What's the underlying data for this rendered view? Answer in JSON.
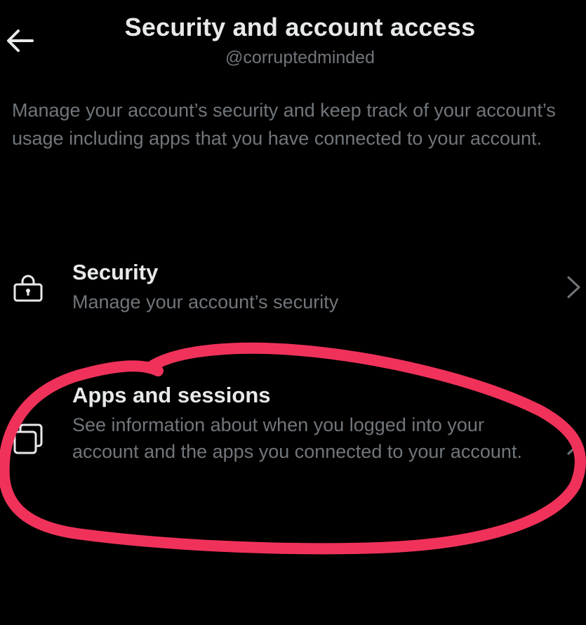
{
  "header": {
    "title": "Security and account access",
    "subtitle": "@corruptedminded",
    "back_icon": "arrow-left-icon"
  },
  "description": "Manage your account’s security and keep track of your account’s usage including apps that you have connected to your account.",
  "menu": {
    "items": [
      {
        "title": "Security",
        "subtitle": "Manage your account’s security",
        "icon": "lock-icon"
      },
      {
        "title": "Apps and sessions",
        "subtitle": "See information about when you logged into your account and the apps you connected to your account.",
        "icon": "stacked-windows-icon"
      }
    ]
  },
  "colors": {
    "background": "#000000",
    "primary_text": "#e7e9ea",
    "secondary_text": "#71767b",
    "annotation_stroke": "#f0325a"
  }
}
